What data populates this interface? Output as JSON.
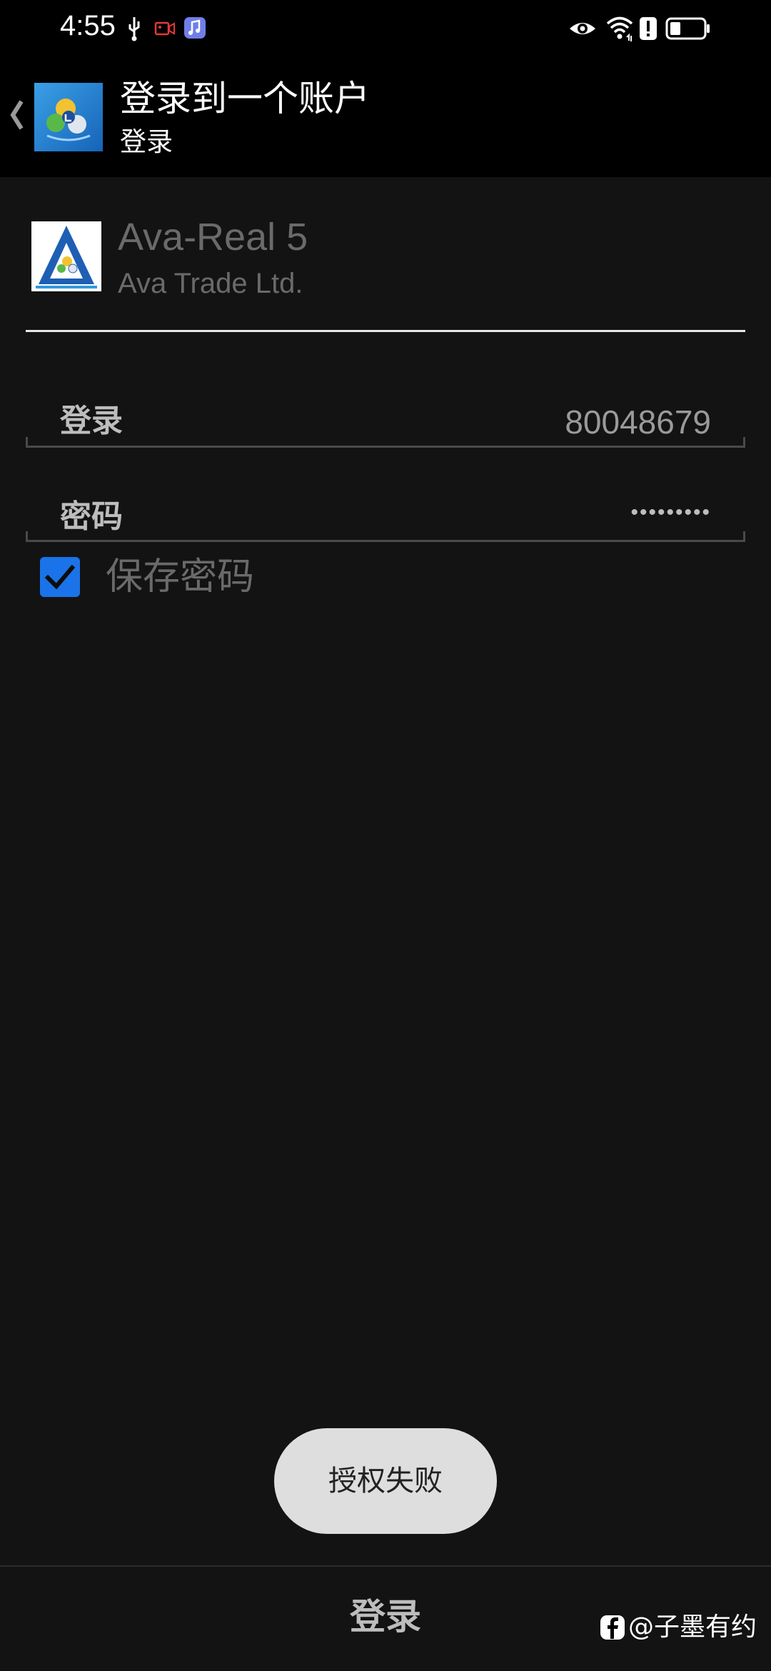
{
  "status_bar": {
    "time": "4:55",
    "icons": [
      "usb-icon",
      "screen-record-icon",
      "music-app-icon",
      "eye-comfort-icon",
      "wifi-icon",
      "alert-icon",
      "battery-icon"
    ]
  },
  "app_bar": {
    "title": "登录到一个账户",
    "subtitle": "登录",
    "back_icon": "chevron-left-icon",
    "logo_icon": "metatrader-logo-icon"
  },
  "server": {
    "name": "Ava-Real 5",
    "company": "Ava Trade Ltd.",
    "logo_icon": "avatrade-logo-icon"
  },
  "fields": {
    "login_label": "登录",
    "login_value": "80048679",
    "password_label": "密码",
    "password_value": "•••••••••"
  },
  "save_password": {
    "label": "保存密码",
    "checked": true
  },
  "toast": {
    "text": "授权失败"
  },
  "bottom": {
    "login_button_label": "登录"
  },
  "watermark": {
    "text": "@子墨有约",
    "logo_icon": "facebook-logo-icon"
  },
  "colors": {
    "background": "#131313",
    "bar_background": "#000000",
    "accent": "#1a73e8",
    "toast_background": "#dedede"
  }
}
